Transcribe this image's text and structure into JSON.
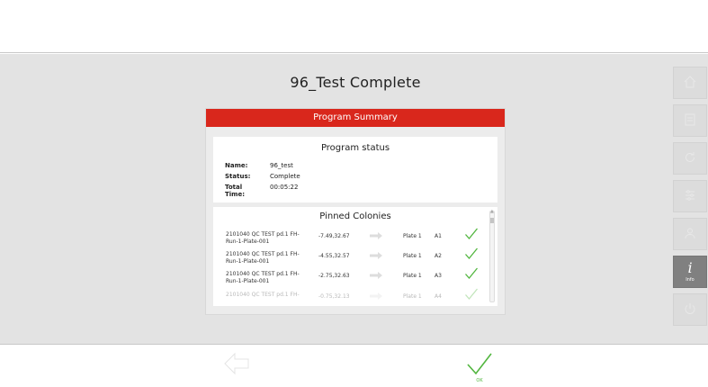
{
  "page": {
    "title": "96_Test Complete"
  },
  "summary": {
    "header": "Program Summary",
    "status_title": "Program status",
    "fields": [
      {
        "key": "Name:",
        "value": "96_test"
      },
      {
        "key": "Status:",
        "value": "Complete"
      },
      {
        "key": "Total Time:",
        "value": "00:05:22"
      }
    ]
  },
  "colonies": {
    "title": "Pinned Colonies",
    "rows": [
      {
        "name": "2101040 QC TEST pd.1 FH-Run-1-Plate-001",
        "coord": "-7.49,32.67",
        "plate": "Plate 1",
        "well": "A1"
      },
      {
        "name": "2101040 QC TEST pd.1 FH-Run-1-Plate-001",
        "coord": "-4.55,32.57",
        "plate": "Plate 1",
        "well": "A2"
      },
      {
        "name": "2101040 QC TEST pd.1 FH-Run-1-Plate-001",
        "coord": "-2.75,32.63",
        "plate": "Plate 1",
        "well": "A3"
      },
      {
        "name": "2101040 QC TEST pd.1 FH-",
        "coord": "-0.75,32.13",
        "plate": "Plate 1",
        "well": "A4"
      }
    ]
  },
  "sidebar": {
    "items": [
      {
        "icon": "home-icon",
        "label": ""
      },
      {
        "icon": "document-icon",
        "label": ""
      },
      {
        "icon": "refresh-icon",
        "label": ""
      },
      {
        "icon": "sliders-icon",
        "label": ""
      },
      {
        "icon": "user-icon",
        "label": ""
      },
      {
        "icon": "info-icon",
        "label": "Info"
      },
      {
        "icon": "power-icon",
        "label": ""
      }
    ]
  },
  "footer": {
    "back_label": "",
    "ok_label": "OK"
  },
  "colors": {
    "accent_red": "#d9271c",
    "ok_green": "#52b63f",
    "active_gray": "#808080"
  }
}
